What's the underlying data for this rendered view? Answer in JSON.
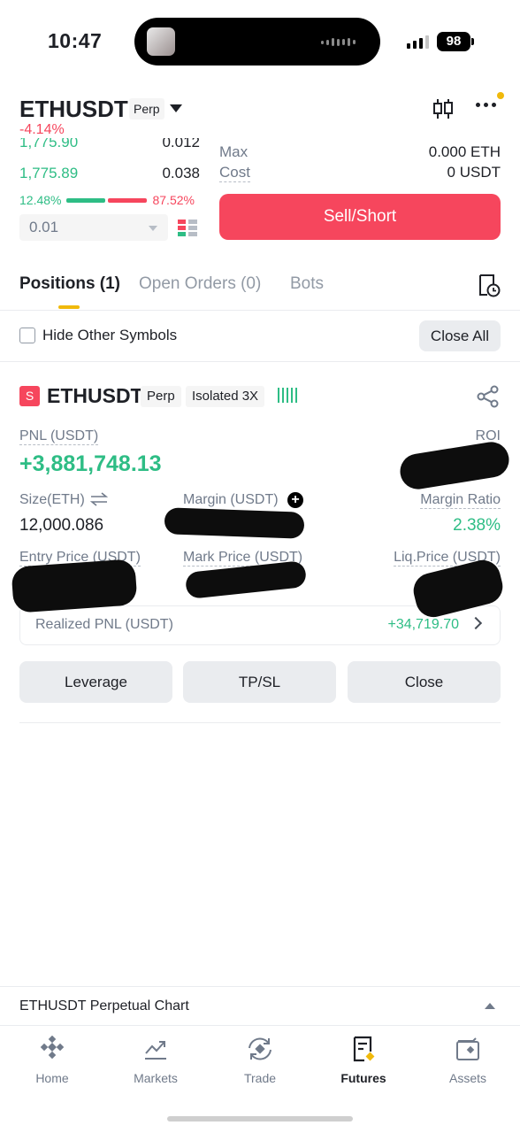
{
  "status_bar": {
    "time": "10:47",
    "battery": "98"
  },
  "header": {
    "symbol": "ETHUSDT",
    "type_tag": "Perp",
    "change": "-4.14%",
    "icons": [
      "candlestick-chart-icon",
      "more-icon"
    ]
  },
  "order_book": {
    "rows": [
      {
        "price": "1,775.90",
        "qty": "0.012"
      },
      {
        "price": "1,775.89",
        "qty": "0.038"
      }
    ],
    "buy_ratio": "12.48%",
    "sell_ratio": "87.52%",
    "buy_fraction": 0.1248,
    "precision": "0.01"
  },
  "order_info": {
    "max_label": "Max",
    "max_value": "0.000 ETH",
    "cost_label": "Cost",
    "cost_value": "0 USDT",
    "sell_button": "Sell/Short"
  },
  "tabs": {
    "positions": "Positions (1)",
    "open_orders": "Open Orders (0)",
    "bots": "Bots"
  },
  "filter": {
    "hide_label": "Hide Other Symbols",
    "close_all": "Close All"
  },
  "position": {
    "side_badge": "S",
    "symbol": "ETHUSDT",
    "type_tag": "Perp",
    "margin_mode": "Isolated 3X",
    "pnl_label": "PNL (USDT)",
    "pnl_value": "+3,881,748.13",
    "roi_label": "ROI",
    "size_label": "Size(ETH)",
    "size_value": "12,000.086",
    "margin_label": "Margin (USDT)",
    "margin_ratio_label": "Margin Ratio",
    "margin_ratio_value": "2.38%",
    "entry_label": "Entry Price (USDT)",
    "mark_label": "Mark Price (USDT)",
    "liq_label": "Liq.Price (USDT)",
    "realized_label": "Realized PNL (USDT)",
    "realized_value": "+34,719.70"
  },
  "actions": {
    "leverage": "Leverage",
    "tpsl": "TP/SL",
    "close": "Close"
  },
  "chart_bar": {
    "label": "ETHUSDT Perpetual Chart"
  },
  "nav": {
    "items": [
      {
        "label": "Home",
        "icon": "home-icon"
      },
      {
        "label": "Markets",
        "icon": "markets-icon"
      },
      {
        "label": "Trade",
        "icon": "trade-icon"
      },
      {
        "label": "Futures",
        "icon": "futures-icon",
        "active": true
      },
      {
        "label": "Assets",
        "icon": "assets-icon"
      }
    ]
  },
  "colors": {
    "green": "#2ebd85",
    "red": "#f6465d",
    "brand_yellow": "#f0b90b"
  }
}
